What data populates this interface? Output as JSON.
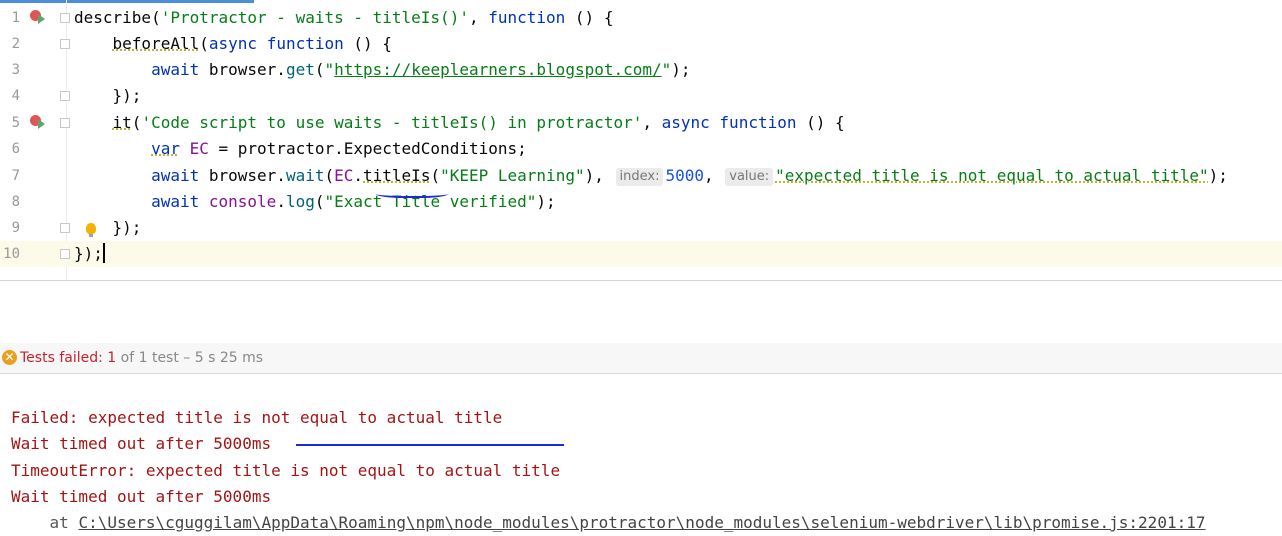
{
  "editor": {
    "lines": [
      {
        "n": "1",
        "tokens": [
          {
            "t": "describe(",
            "c": ""
          },
          {
            "t": "'Protractor - waits - titleIs()'",
            "c": "str"
          },
          {
            "t": ", ",
            "c": ""
          },
          {
            "t": "function",
            "c": "kw"
          },
          {
            "t": " () {",
            "c": ""
          }
        ]
      },
      {
        "n": "2",
        "tokens": [
          {
            "t": "    ",
            "c": ""
          },
          {
            "t": "beforeAll",
            "c": "wavy"
          },
          {
            "t": "(",
            "c": ""
          },
          {
            "t": "async",
            "c": "kw"
          },
          {
            "t": " ",
            "c": ""
          },
          {
            "t": "function",
            "c": "kw"
          },
          {
            "t": " () {",
            "c": ""
          }
        ]
      },
      {
        "n": "3",
        "tokens": [
          {
            "t": "        ",
            "c": ""
          },
          {
            "t": "await",
            "c": "kw"
          },
          {
            "t": " browser.",
            "c": ""
          },
          {
            "t": "get",
            "c": "fn"
          },
          {
            "t": "(",
            "c": ""
          },
          {
            "t": "\"",
            "c": "str"
          },
          {
            "t": "https://keeplearners.blogspot.com/",
            "c": "str u"
          },
          {
            "t": "\"",
            "c": "str"
          },
          {
            "t": ");",
            "c": ""
          }
        ]
      },
      {
        "n": "4",
        "tokens": [
          {
            "t": "    });",
            "c": ""
          }
        ]
      },
      {
        "n": "5",
        "tokens": [
          {
            "t": "    ",
            "c": ""
          },
          {
            "t": "it",
            "c": "wavy"
          },
          {
            "t": "(",
            "c": ""
          },
          {
            "t": "'Code script to use waits - titleIs() in protractor'",
            "c": "str"
          },
          {
            "t": ", ",
            "c": ""
          },
          {
            "t": "async",
            "c": "kw"
          },
          {
            "t": " ",
            "c": ""
          },
          {
            "t": "function",
            "c": "kw"
          },
          {
            "t": " () {",
            "c": ""
          }
        ]
      },
      {
        "n": "6",
        "tokens": [
          {
            "t": "        ",
            "c": ""
          },
          {
            "t": "var",
            "c": "kw wavy"
          },
          {
            "t": " ",
            "c": ""
          },
          {
            "t": "EC",
            "c": "prop"
          },
          {
            "t": " = protractor.ExpectedConditions;",
            "c": ""
          }
        ]
      },
      {
        "n": "7",
        "tokens": [
          {
            "t": "        ",
            "c": ""
          },
          {
            "t": "await",
            "c": "kw"
          },
          {
            "t": " browser.",
            "c": ""
          },
          {
            "t": "wait",
            "c": "fn"
          },
          {
            "t": "(",
            "c": ""
          },
          {
            "t": "EC",
            "c": "prop"
          },
          {
            "t": ".",
            "c": ""
          },
          {
            "t": "titleIs",
            "c": "wavy"
          },
          {
            "t": "(",
            "c": ""
          },
          {
            "t": "\"KEEP Learning\"",
            "c": "str"
          },
          {
            "t": "), ",
            "c": ""
          },
          {
            "t": "index:",
            "c": "hint"
          },
          {
            "t": "5000",
            "c": "num"
          },
          {
            "t": ", ",
            "c": ""
          },
          {
            "t": "value:",
            "c": "hint"
          },
          {
            "t": "\"expected title is not equal to actual title\"",
            "c": "str wavy"
          },
          {
            "t": ");",
            "c": ""
          }
        ]
      },
      {
        "n": "8",
        "tokens": [
          {
            "t": "        ",
            "c": ""
          },
          {
            "t": "await",
            "c": "kw"
          },
          {
            "t": " ",
            "c": ""
          },
          {
            "t": "console",
            "c": "prop"
          },
          {
            "t": ".",
            "c": ""
          },
          {
            "t": "log",
            "c": "fn"
          },
          {
            "t": "(",
            "c": ""
          },
          {
            "t": "\"Exact Title verified\"",
            "c": "str"
          },
          {
            "t": ");",
            "c": ""
          }
        ]
      },
      {
        "n": "9",
        "tokens": [
          {
            "t": "    });",
            "c": ""
          }
        ]
      },
      {
        "n": "10",
        "tokens": [
          {
            "t": "});",
            "c": ""
          }
        ]
      }
    ]
  },
  "test_status": {
    "label": "Tests failed:",
    "failed_count": "1",
    "detail": "of 1 test – 5 s 25 ms"
  },
  "output": [
    {
      "text": "Failed: expected title is not equal to actual title"
    },
    {
      "text": "Wait timed out after 5000ms"
    },
    {
      "text": "TimeoutError: expected title is not equal to actual title"
    },
    {
      "text": "Wait timed out after 5000ms"
    }
  ],
  "stack_line": {
    "prefix": "    at ",
    "path": "C:\\Users\\cguggilam\\AppData\\Roaming\\npm\\node_modules\\protractor\\node_modules\\selenium-webdriver\\lib\\promise.js:2201:17"
  },
  "colors": {
    "keyword": "#0033b3",
    "string": "#067d17",
    "error_text": "#a31515",
    "annotation_blue": "#1a2bd6"
  }
}
